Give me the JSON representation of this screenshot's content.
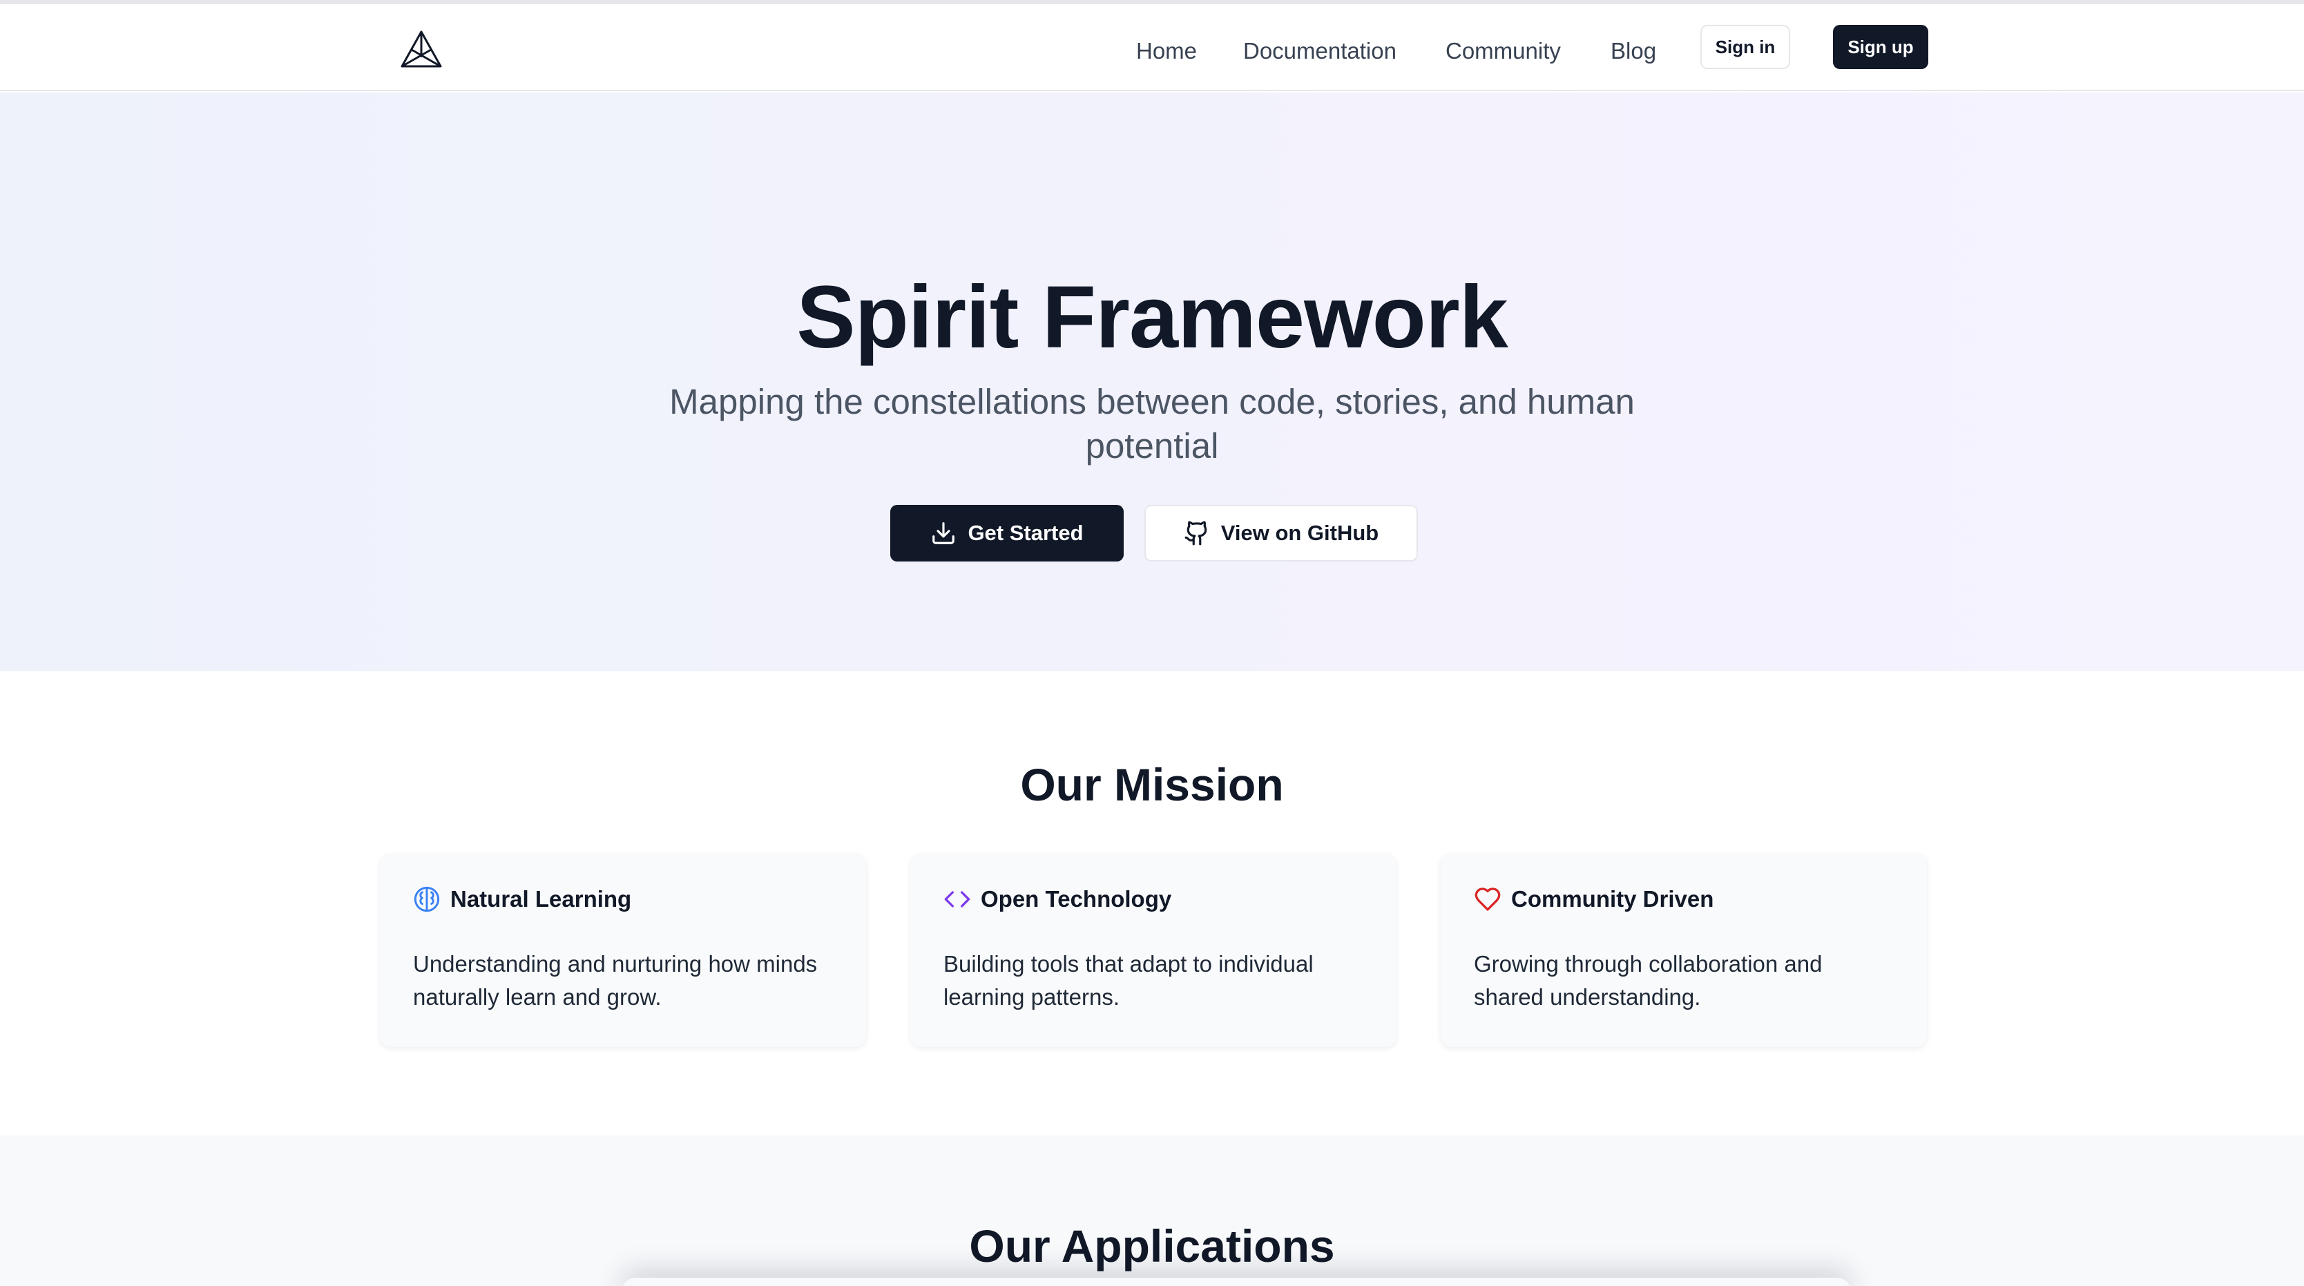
{
  "header": {
    "logo": "spirit-triangle-logo",
    "nav": [
      {
        "label": "Home"
      },
      {
        "label": "Documentation"
      },
      {
        "label": "Community"
      },
      {
        "label": "Blog"
      }
    ],
    "signin_label": "Sign in",
    "signup_label": "Sign up"
  },
  "hero": {
    "title": "Spirit Framework",
    "subtitle": "Mapping the constellations between code, stories, and human potential",
    "primary_button": {
      "label": "Get Started",
      "icon": "download-icon"
    },
    "secondary_button": {
      "label": "View on GitHub",
      "icon": "github-icon"
    }
  },
  "mission": {
    "title": "Our Mission",
    "cards": [
      {
        "title": "Natural Learning",
        "icon": "brain-icon",
        "icon_color": "#3b82f6",
        "text": "Understanding and nurturing how minds naturally learn and grow."
      },
      {
        "title": "Open Technology",
        "icon": "code-icon",
        "icon_color": "#7c3aed",
        "text": "Building tools that adapt to individual learning patterns."
      },
      {
        "title": "Community Driven",
        "icon": "heart-icon",
        "icon_color": "#dc2626",
        "text": "Growing through collaboration and shared understanding."
      }
    ]
  },
  "applications": {
    "title": "Our Applications"
  },
  "colors": {
    "primary_dark": "#111827",
    "hero_bg_start": "#eef2fb",
    "hero_bg_end": "#f5f3fe"
  }
}
